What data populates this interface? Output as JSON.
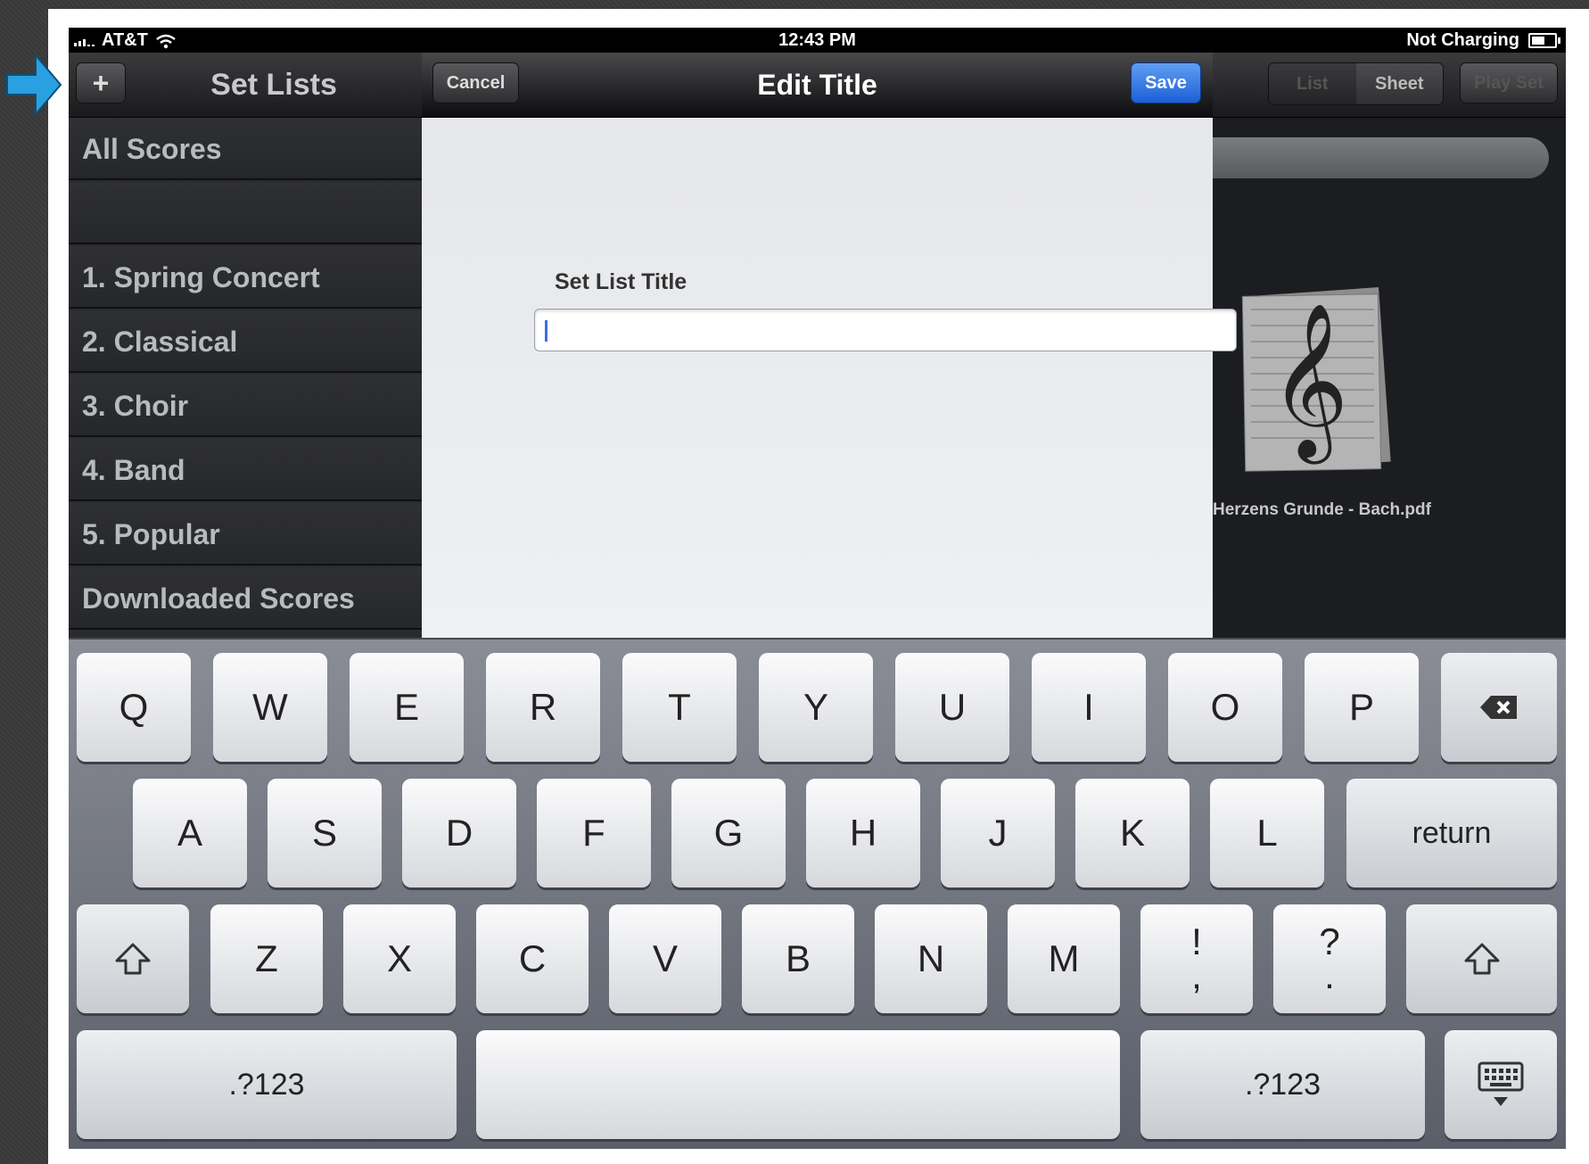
{
  "status_bar": {
    "carrier": "AT&T",
    "time": "12:43 PM",
    "battery_text": "Not Charging"
  },
  "nav": {
    "add_label": "+",
    "title": "Set Lists",
    "segments": [
      "List",
      "Sheet"
    ],
    "play_set": "Play Set"
  },
  "modal": {
    "cancel": "Cancel",
    "title": "Edit Title",
    "save": "Save",
    "field_label": "Set List Title",
    "field_value": ""
  },
  "sidebar": {
    "items": [
      "All Scores",
      "",
      "1. Spring Concert",
      "2. Classical",
      "3. Choir",
      "4. Band",
      "5. Popular",
      "Downloaded Scores"
    ]
  },
  "content": {
    "score_name": "Herzens Grunde - Bach.pdf"
  },
  "keyboard": {
    "row1": [
      "Q",
      "W",
      "E",
      "R",
      "T",
      "Y",
      "U",
      "I",
      "O",
      "P"
    ],
    "row2": [
      "A",
      "S",
      "D",
      "F",
      "G",
      "H",
      "J",
      "K",
      "L"
    ],
    "return": "return",
    "row3": [
      "Z",
      "X",
      "C",
      "V",
      "B",
      "N",
      "M"
    ],
    "punct1": [
      "!",
      ","
    ],
    "punct2": [
      "?",
      "."
    ],
    "numbers": ".?123"
  },
  "colors": {
    "accent_save": "#1d5fd6",
    "annotation_arrow": "#2aa0e0"
  }
}
